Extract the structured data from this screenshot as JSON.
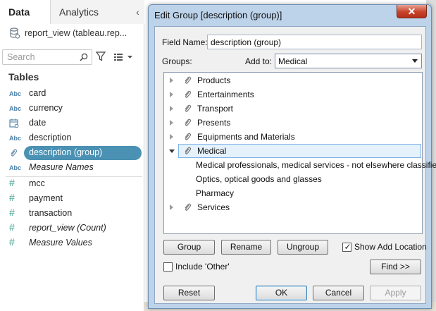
{
  "left_pane": {
    "tabs": {
      "data": "Data",
      "analytics": "Analytics"
    },
    "collapse_glyph": "‹",
    "datasource": "report_view (tableau.rep...",
    "search_placeholder": "Search",
    "tables_heading": "Tables",
    "dimensions": [
      {
        "icon": "Abc",
        "icon_name": "string-type-icon",
        "name": "card"
      },
      {
        "icon": "Abc",
        "icon_name": "string-type-icon",
        "name": "currency"
      },
      {
        "icon": "",
        "icon_name": "date-type-icon",
        "name": "date"
      },
      {
        "icon": "Abc",
        "icon_name": "string-type-icon",
        "name": "description"
      },
      {
        "icon": "",
        "icon_name": "group-paperclip-icon",
        "name": "description (group)",
        "selected": true
      },
      {
        "icon": "Abc",
        "icon_name": "string-type-icon",
        "name": "Measure Names",
        "italic": true
      }
    ],
    "measures": [
      {
        "icon": "#",
        "name": "mcc"
      },
      {
        "icon": "#",
        "name": "payment"
      },
      {
        "icon": "#",
        "name": "transaction"
      },
      {
        "icon": "#",
        "name": "report_view (Count)",
        "italic": true
      },
      {
        "icon": "#",
        "name": "Measure Values",
        "italic": true
      }
    ]
  },
  "dialog": {
    "title": "Edit Group [description (group)]",
    "close_glyph": "✕",
    "field_name_label": "Field Name:",
    "field_name_value": "description (group)",
    "groups_label": "Groups:",
    "add_to_label": "Add to:",
    "add_to_value": "Medical",
    "tree": [
      {
        "label": "Products",
        "expanded": false
      },
      {
        "label": "Entertainments",
        "expanded": false
      },
      {
        "label": "Transport",
        "expanded": false
      },
      {
        "label": "Presents",
        "expanded": false
      },
      {
        "label": "Equipments and Materials",
        "expanded": false
      },
      {
        "label": "Medical",
        "expanded": true,
        "selected": true,
        "children": [
          "Medical professionals, medical services - not elsewhere classified",
          "Optics, optical goods and glasses",
          "Pharmacy"
        ]
      },
      {
        "label": "Services",
        "expanded": false
      }
    ],
    "buttons": {
      "group": "Group",
      "rename": "Rename",
      "ungroup": "Ungroup",
      "find": "Find >>",
      "reset": "Reset",
      "ok": "OK",
      "cancel": "Cancel",
      "apply": "Apply"
    },
    "show_add_location": {
      "label": "Show Add Location",
      "checked": true
    },
    "include_other": {
      "label": "Include 'Other'",
      "checked": false
    }
  },
  "colors": {
    "selected_pill": "#4a91b3",
    "abc_icon": "#4a7ea6",
    "measure_icon": "#3d9f8c",
    "dialog_frame": "#bcd3ea",
    "close_button": "#c7432a"
  }
}
